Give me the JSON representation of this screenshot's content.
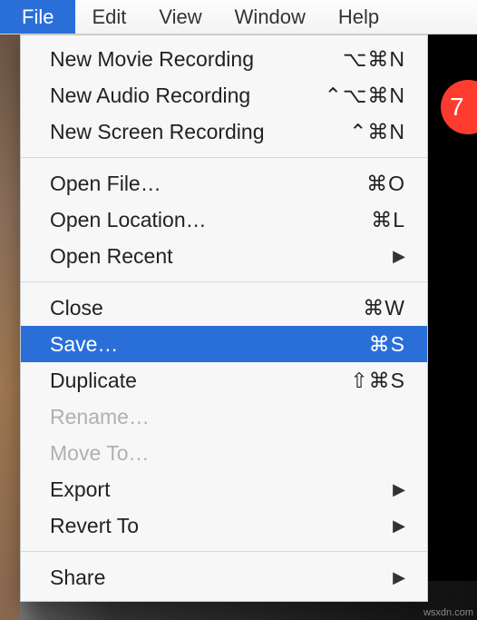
{
  "menubar": {
    "items": [
      {
        "label": "File",
        "active": true
      },
      {
        "label": "Edit",
        "active": false
      },
      {
        "label": "View",
        "active": false
      },
      {
        "label": "Window",
        "active": false
      },
      {
        "label": "Help",
        "active": false
      }
    ]
  },
  "dropdown": {
    "groups": [
      [
        {
          "label": "New Movie Recording",
          "shortcut": "⌥⌘N",
          "disabled": false,
          "highlighted": false,
          "submenu": false
        },
        {
          "label": "New Audio Recording",
          "shortcut": "⌃⌥⌘N",
          "disabled": false,
          "highlighted": false,
          "submenu": false
        },
        {
          "label": "New Screen Recording",
          "shortcut": "⌃⌘N",
          "disabled": false,
          "highlighted": false,
          "submenu": false
        }
      ],
      [
        {
          "label": "Open File…",
          "shortcut": "⌘O",
          "disabled": false,
          "highlighted": false,
          "submenu": false
        },
        {
          "label": "Open Location…",
          "shortcut": "⌘L",
          "disabled": false,
          "highlighted": false,
          "submenu": false
        },
        {
          "label": "Open Recent",
          "shortcut": "",
          "disabled": false,
          "highlighted": false,
          "submenu": true
        }
      ],
      [
        {
          "label": "Close",
          "shortcut": "⌘W",
          "disabled": false,
          "highlighted": false,
          "submenu": false
        },
        {
          "label": "Save…",
          "shortcut": "⌘S",
          "disabled": false,
          "highlighted": true,
          "submenu": false
        },
        {
          "label": "Duplicate",
          "shortcut": "⇧⌘S",
          "disabled": false,
          "highlighted": false,
          "submenu": false
        },
        {
          "label": "Rename…",
          "shortcut": "",
          "disabled": true,
          "highlighted": false,
          "submenu": false
        },
        {
          "label": "Move To…",
          "shortcut": "",
          "disabled": true,
          "highlighted": false,
          "submenu": false
        },
        {
          "label": "Export",
          "shortcut": "",
          "disabled": false,
          "highlighted": false,
          "submenu": true
        },
        {
          "label": "Revert To",
          "shortcut": "",
          "disabled": false,
          "highlighted": false,
          "submenu": true
        }
      ],
      [
        {
          "label": "Share",
          "shortcut": "",
          "disabled": false,
          "highlighted": false,
          "submenu": true
        }
      ]
    ]
  },
  "badge": {
    "value": "7"
  },
  "watermark": "wsxdn.com"
}
